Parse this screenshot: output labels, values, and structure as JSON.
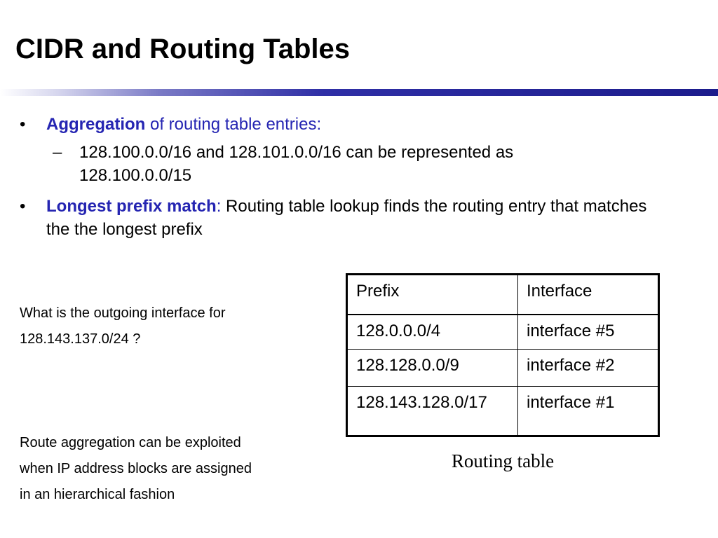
{
  "title": "CIDR and Routing Tables",
  "bullets": [
    {
      "marker": "•",
      "emphasis": "Aggregation",
      "rest": " of routing table entries:"
    },
    {
      "marker": "•",
      "emphasis": "Longest prefix match",
      "colon": ":",
      "rest": " Routing table lookup finds the routing entry that matches the the longest prefix"
    }
  ],
  "sub_bullet": {
    "marker": "–",
    "text": "128.100.0.0/16 and 128.101.0.0/16 can be represented as 128.100.0.0/15"
  },
  "question": {
    "line1": "What is the outgoing interface for",
    "line2": "128.143.137.0/24 ?"
  },
  "note": {
    "line1": "Route aggregation can be exploited",
    "line2": "when IP address blocks are assigned",
    "line3": "in an hierarchical fashion"
  },
  "routing_table": {
    "headers": [
      "Prefix",
      "Interface"
    ],
    "rows": [
      [
        "128.0.0.0/4",
        "interface #5"
      ],
      [
        "128.128.0.0/9",
        "interface #2"
      ],
      [
        "128.143.128.0/17",
        "interface #1"
      ]
    ],
    "caption": "Routing table"
  },
  "colors": {
    "emphasis_blue": "#2525b2",
    "rule_dark_blue": "#1c1c8c"
  }
}
